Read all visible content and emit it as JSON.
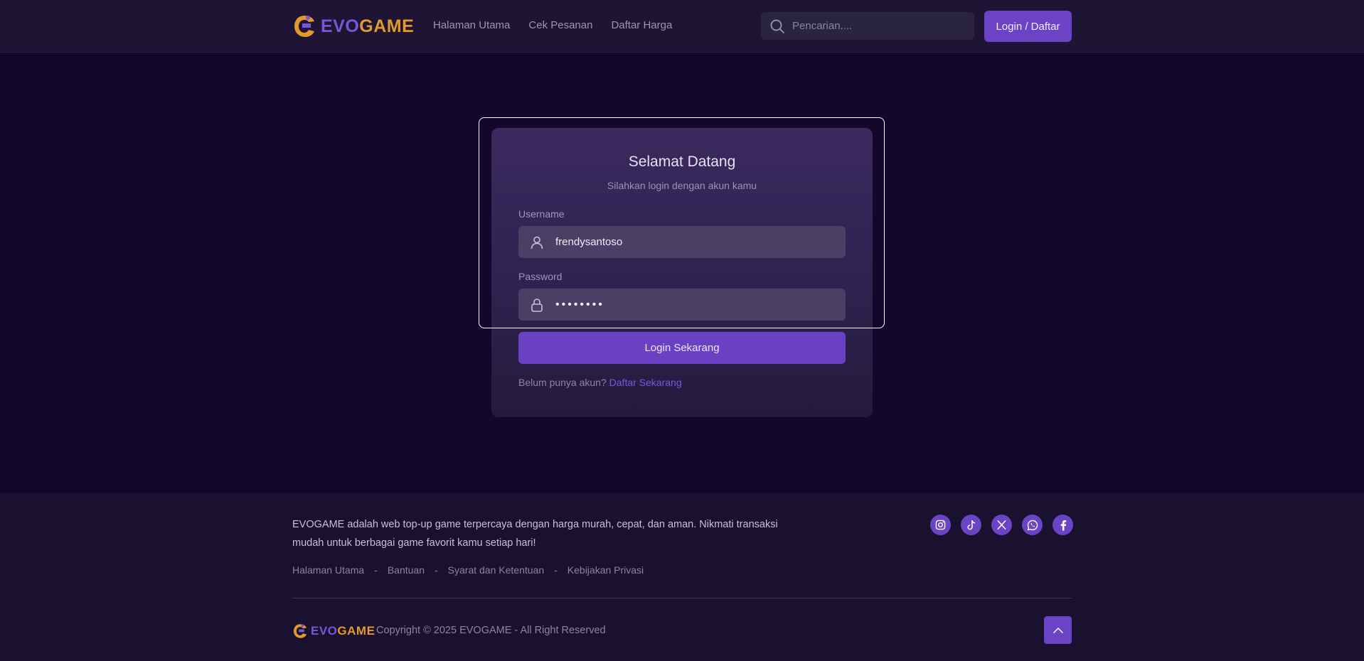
{
  "brand": {
    "name_part1": "EVO",
    "name_part2": "GAME",
    "colors": {
      "purple": "#7a56d6",
      "orange": "#e19a2b",
      "accent": "#6a41c2"
    }
  },
  "header": {
    "nav": [
      "Halaman Utama",
      "Cek Pesanan",
      "Daftar Harga"
    ],
    "search_placeholder": "Pencarian....",
    "login_button": "Login / Daftar"
  },
  "login": {
    "title": "Selamat Datang",
    "subtitle": "Silahkan login dengan akun kamu",
    "username_label": "Username",
    "username_value": "frendysantoso",
    "password_label": "Password",
    "password_value": "••••••••",
    "submit_label": "Login Sekarang",
    "register_prompt": "Belum punya akun?",
    "register_link": "Daftar Sekarang"
  },
  "footer": {
    "description": "EVOGAME adalah web top-up game terpercaya dengan harga murah, cepat, dan aman. Nikmati transaksi mudah untuk berbagai game favorit kamu setiap hari!",
    "links": [
      "Halaman Utama",
      "Bantuan",
      "Syarat dan Ketentuan",
      "Kebijakan Privasi"
    ],
    "separator": "-",
    "socials": [
      "instagram-icon",
      "tiktok-icon",
      "x-twitter-icon",
      "whatsapp-icon",
      "facebook-icon"
    ],
    "copyright": "Copyright © 2025 EVOGAME - All Right Reserved"
  }
}
